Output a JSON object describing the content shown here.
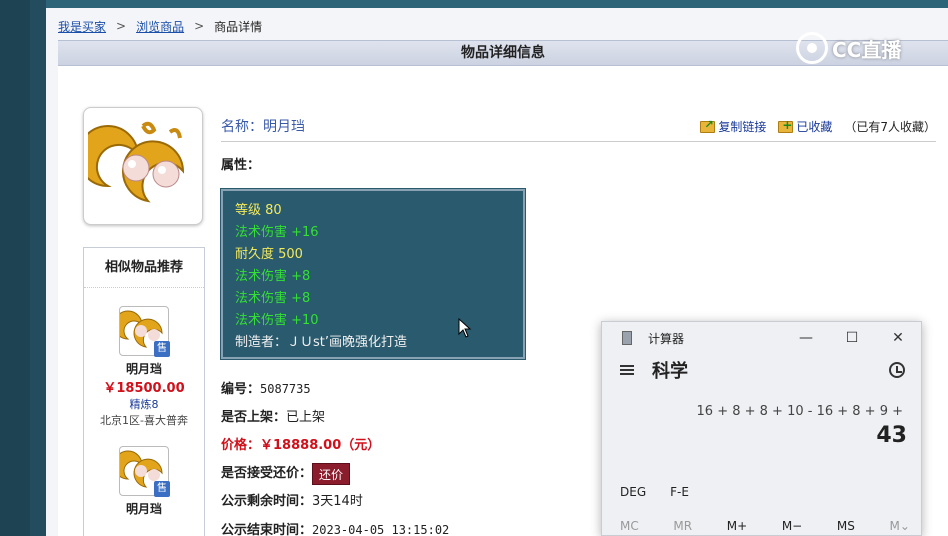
{
  "breadcrumb": {
    "items": [
      "我是买家",
      "浏览商品"
    ],
    "current": "商品详情",
    "separator": ">"
  },
  "page_title": "物品详细信息",
  "watermark": "CC直播",
  "item": {
    "name_label": "名称：",
    "name": "明月珰",
    "copy_link": "复制链接",
    "favorited": "已收藏",
    "favorite_count_text": "（已有7人收藏）",
    "attributes_label": "属性：",
    "attributes": [
      {
        "text": "等级 80",
        "color": "yellow"
      },
      {
        "text": "法术伤害 +16",
        "color": "yellow"
      },
      {
        "text": "耐久度 500",
        "color": "yellow"
      },
      {
        "text": "法术伤害 +8",
        "color": "green"
      },
      {
        "text": "法术伤害 +8",
        "color": "green"
      },
      {
        "text": "法术伤害 +10",
        "color": "green"
      },
      {
        "text": "制造者：ＪＵst’画晚强化打造",
        "color": "white"
      }
    ],
    "id_label": "编号：",
    "id": "5087735",
    "listed_label": "是否上架：",
    "listed": "已上架",
    "price_label": "价格：",
    "price": "￥18888.00（元）",
    "bargain_label": "是否接受还价：",
    "bargain_button": "还价",
    "remaining_label": "公示剩余时间：",
    "remaining": "3天14时",
    "end_label": "公示结束时间：",
    "end_time": "2023-04-05 13:15:02"
  },
  "similar": {
    "title": "相似物品推荐",
    "sale_badge": "售",
    "items": [
      {
        "name": "明月珰",
        "price": "￥18500.00",
        "tag": "精炼8",
        "server": "北京1区-喜大普奔"
      },
      {
        "name": "明月珰",
        "price": "",
        "tag": "",
        "server": ""
      }
    ]
  },
  "calculator": {
    "title": "计算器",
    "mode": "科学",
    "expression": "16 + 8 + 8 + 10 - 16 + 8 + 9 +",
    "result": "43",
    "angle_buttons": [
      "DEG",
      "F-E"
    ],
    "memory_buttons": [
      "MC",
      "MR",
      "M+",
      "M−",
      "MS",
      "M⌄"
    ]
  },
  "colors": {
    "attr_bg": "#2a5a6e",
    "attr_yellow": "#f2e95c",
    "attr_green": "#33e033",
    "price_red": "#d0101a",
    "bargain_bg": "#8b1c2c",
    "link_blue": "#1a4ea8"
  }
}
